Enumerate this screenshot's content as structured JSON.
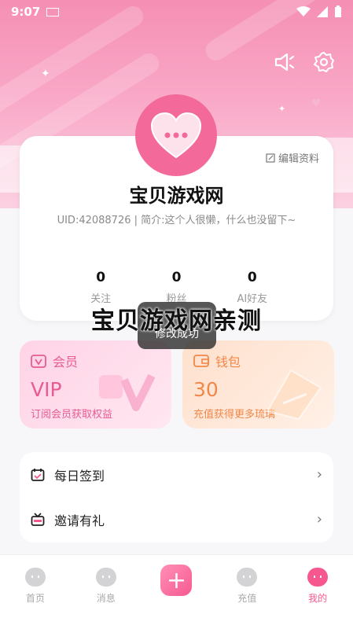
{
  "status_bar": {
    "time": "9:07"
  },
  "profile": {
    "edit_label": "编辑资料",
    "nickname": "宝贝游戏网",
    "uid_line": "UID:42088726 | 简介:这个人很懒，什么也没留下~",
    "stats": [
      {
        "value": "0",
        "label": "关注"
      },
      {
        "value": "0",
        "label": "粉丝"
      },
      {
        "value": "0",
        "label": "AI好友"
      }
    ]
  },
  "overlay": {
    "watermark": "宝贝游戏网亲测",
    "toast": "修改成功"
  },
  "promos": {
    "vip": {
      "title": "会员",
      "big": "VIP",
      "sub": "订阅会员获取权益"
    },
    "wallet": {
      "title": "钱包",
      "big": "30",
      "sub": "充值获得更多琉璃"
    }
  },
  "menu": [
    {
      "label": "每日签到",
      "icon": "calendar-check-icon"
    },
    {
      "label": "邀请有礼",
      "icon": "gift-tv-icon"
    }
  ],
  "tabs": [
    {
      "label": "首页",
      "active": false
    },
    {
      "label": "消息",
      "active": false
    },
    {
      "label": "",
      "active": false
    },
    {
      "label": "充值",
      "active": false
    },
    {
      "label": "我的",
      "active": true
    }
  ],
  "colors": {
    "accent": "#f7578f",
    "hero": "#f58fb4",
    "vip": "#e85b93",
    "wallet": "#f0884a"
  }
}
